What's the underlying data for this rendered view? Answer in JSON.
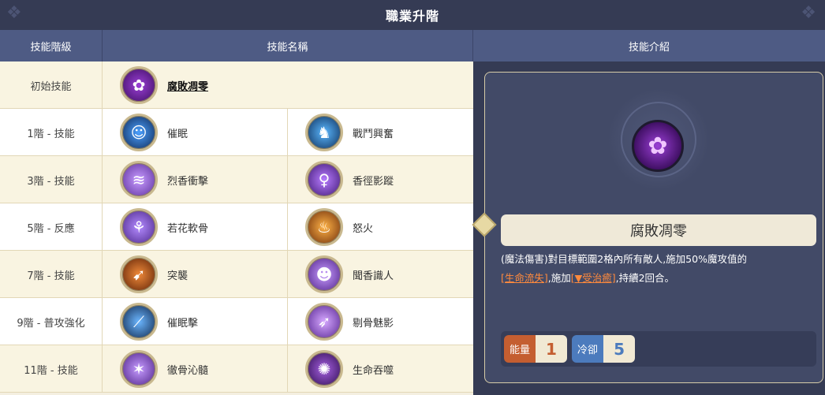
{
  "title": "職業升階",
  "columns": {
    "tier": "技能階級",
    "name": "技能名稱",
    "intro": "技能介紹"
  },
  "rows": [
    {
      "tier": "初始技能",
      "skills": [
        "腐敗凋零"
      ]
    },
    {
      "tier": "1階 - 技能",
      "skills": [
        "催眠",
        "戰鬥興奮"
      ]
    },
    {
      "tier": "3階 - 技能",
      "skills": [
        "烈香衝擊",
        "香徑影蹤"
      ]
    },
    {
      "tier": "5階 - 反應",
      "skills": [
        "若花軟骨",
        "怒火"
      ]
    },
    {
      "tier": "7階 - 技能",
      "skills": [
        "突襲",
        "聞香識人"
      ]
    },
    {
      "tier": "9階 - 普攻強化",
      "skills": [
        "催眠擊",
        "剔骨魅影"
      ]
    },
    {
      "tier": "11階 - 技能",
      "skills": [
        "徹骨沁髓",
        "生命吞噬"
      ]
    }
  ],
  "detail": {
    "name": "腐敗凋零",
    "desc_part1": "(魔法傷害)對目標範圍2格內所有敵人,施加50%魔攻值的",
    "link1": "[生命流失]",
    "desc_part2": ",施加",
    "link2": "[▼受治癒]",
    "desc_part3": ",持續2回合。",
    "energy_label": "能量",
    "energy_value": "1",
    "cooldown_label": "冷卻",
    "cooldown_value": "5"
  },
  "colors": {
    "title_bg": "#353b54",
    "header_bg": "#4e5b84",
    "accent_orange": "#c45e31",
    "accent_blue": "#4c7bbd",
    "highlight": "#ff8a3d"
  }
}
